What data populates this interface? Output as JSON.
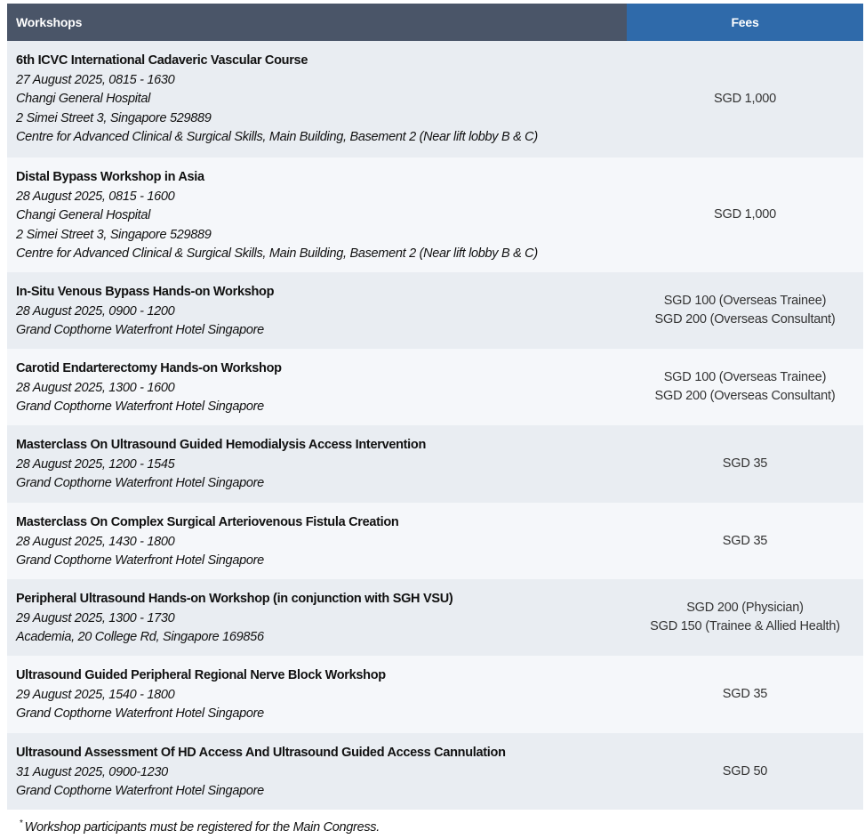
{
  "table": {
    "headers": {
      "workshops": "Workshops",
      "fees": "Fees"
    },
    "rows": [
      {
        "title": "6th ICVC International Cadaveric Vascular Course",
        "details": [
          "27 August 2025, 0815 - 1630",
          "Changi General Hospital",
          "2 Simei Street 3, Singapore 529889",
          "Centre for Advanced Clinical & Surgical Skills, Main Building, Basement 2 (Near lift lobby B & C)"
        ],
        "fees": [
          "SGD 1,000"
        ]
      },
      {
        "title": "Distal Bypass Workshop in Asia",
        "details": [
          "28 August 2025, 0815 - 1600",
          "Changi General Hospital",
          "2 Simei Street 3, Singapore 529889",
          "Centre for Advanced Clinical & Surgical Skills, Main Building, Basement 2 (Near lift lobby B & C)"
        ],
        "fees": [
          "SGD 1,000"
        ]
      },
      {
        "title": "In-Situ Venous Bypass Hands-on Workshop",
        "details": [
          "28 August 2025, 0900 - 1200",
          "Grand Copthorne Waterfront Hotel Singapore"
        ],
        "fees": [
          "SGD 100 (Overseas Trainee)",
          "SGD 200 (Overseas Consultant)"
        ]
      },
      {
        "title": "Carotid Endarterectomy Hands-on Workshop",
        "details": [
          "28 August 2025, 1300 - 1600",
          "Grand Copthorne Waterfront Hotel Singapore"
        ],
        "fees": [
          "SGD 100 (Overseas Trainee)",
          "SGD 200 (Overseas Consultant)"
        ]
      },
      {
        "title": "Masterclass On Ultrasound Guided Hemodialysis Access Intervention",
        "details": [
          "28 August 2025, 1200 - 1545",
          "Grand Copthorne Waterfront Hotel Singapore"
        ],
        "fees": [
          "SGD 35"
        ]
      },
      {
        "title": "Masterclass On Complex Surgical Arteriovenous Fistula Creation",
        "details": [
          "28 August 2025, 1430 - 1800",
          "Grand Copthorne Waterfront Hotel Singapore"
        ],
        "fees": [
          "SGD 35"
        ]
      },
      {
        "title": "Peripheral Ultrasound Hands-on Workshop (in conjunction with SGH VSU)",
        "details": [
          "29 August 2025, 1300 - 1730",
          "Academia, 20 College Rd, Singapore 169856"
        ],
        "fees": [
          "SGD 200 (Physician)",
          "SGD 150 (Trainee & Allied Health)"
        ]
      },
      {
        "title": "Ultrasound Guided Peripheral Regional Nerve Block Workshop",
        "details": [
          "29 August 2025, 1540 - 1800",
          "Grand Copthorne Waterfront Hotel Singapore"
        ],
        "fees": [
          "SGD 35"
        ]
      },
      {
        "title": "Ultrasound Assessment Of HD Access And Ultrasound Guided Access Cannulation",
        "details": [
          "31 August 2025, 0900-1230",
          "Grand Copthorne Waterfront Hotel Singapore"
        ],
        "fees": [
          "SGD 50"
        ]
      }
    ]
  },
  "footnote": {
    "marker": "*",
    "text": "Workshop participants must be registered for the Main Congress."
  },
  "colors": {
    "header_workshops_bg": "#4a5568",
    "header_fees_bg": "#2f6aaa",
    "row_odd_bg": "#e9edf2",
    "row_even_bg": "#f5f7fa"
  }
}
